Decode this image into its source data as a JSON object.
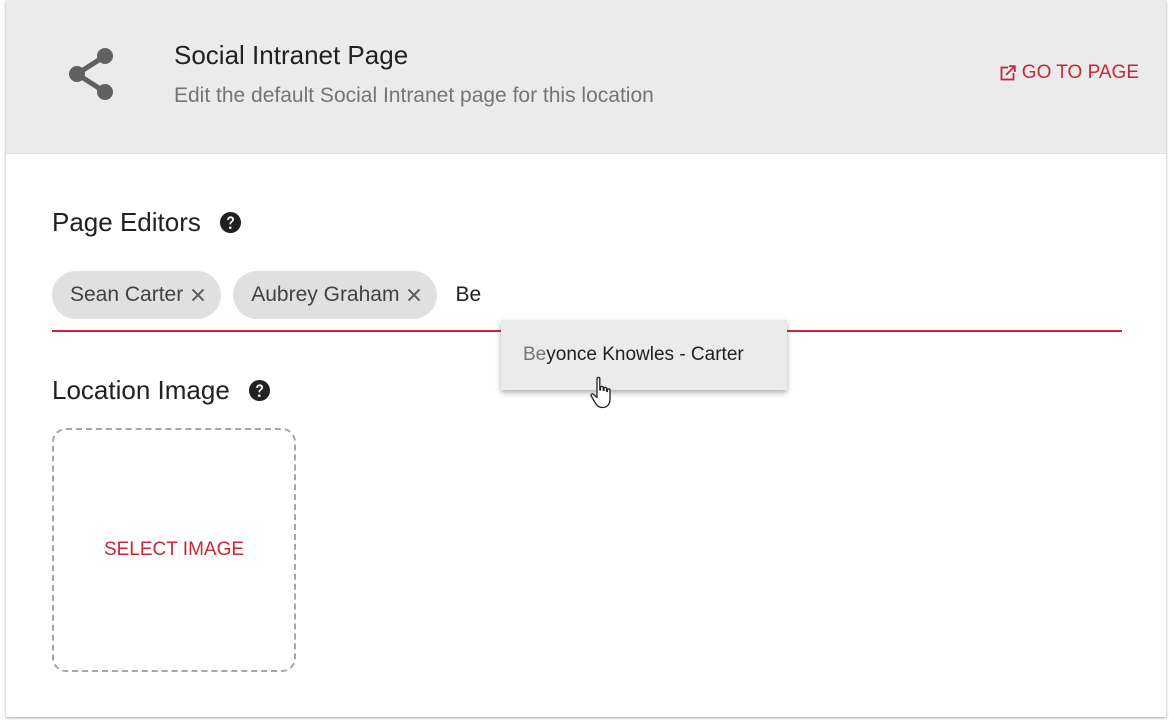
{
  "header": {
    "title": "Social Intranet Page",
    "subtitle": "Edit the default Social Intranet page for this location",
    "icon": "share-icon",
    "goto_label": "GO TO PAGE",
    "goto_icon": "open-in-new-icon"
  },
  "page_editors": {
    "title": "Page Editors",
    "help_icon": "help-circle-icon",
    "chips": [
      {
        "label": "Sean Carter"
      },
      {
        "label": "Aubrey Graham"
      }
    ],
    "input_value": "Be",
    "suggestions": [
      {
        "match": "Be",
        "rest": "yonce Knowles - Carter"
      }
    ]
  },
  "location_image": {
    "title": "Location Image",
    "help_icon": "help-circle-icon",
    "select_label": "SELECT IMAGE"
  },
  "colors": {
    "accent": "#c62839",
    "header_bg": "#ebebeb",
    "chip_bg": "#e0e0e0"
  }
}
